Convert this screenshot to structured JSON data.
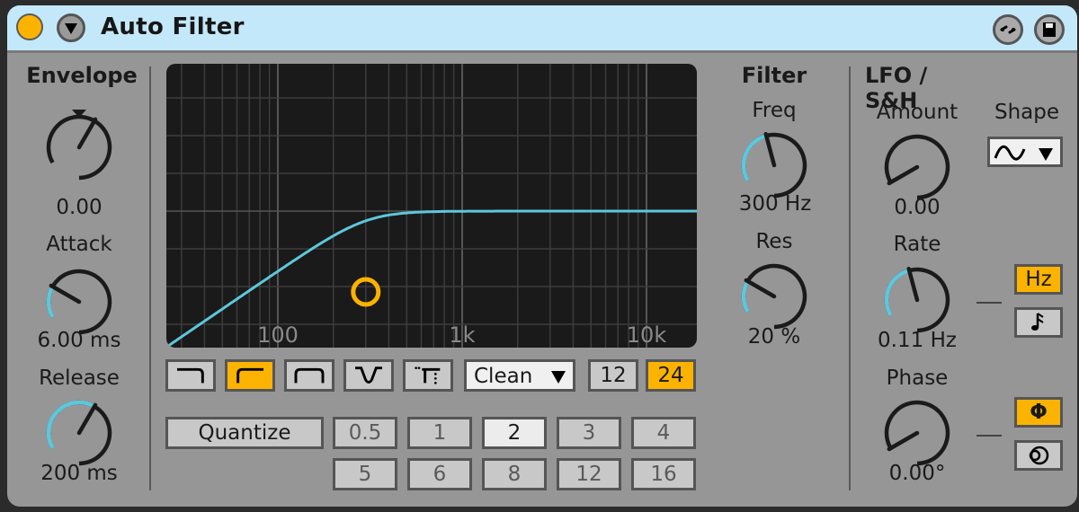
{
  "device": {
    "title": "Auto Filter",
    "power_on": true,
    "icons": {
      "power": "device-power-icon",
      "collapse": "triangle-down-icon",
      "hotswap": "hot-swap-icon",
      "save": "save-preset-icon"
    }
  },
  "envelope": {
    "title": "Envelope",
    "amount": {
      "label": "",
      "value": "0.00",
      "position": 0.5,
      "bipolar": true
    },
    "attack": {
      "label": "Attack",
      "value": "6.00 ms",
      "position": 0.2
    },
    "release": {
      "label": "Release",
      "value": "200 ms",
      "position": 0.5
    }
  },
  "graph": {
    "freq_labels": [
      "100",
      "1k",
      "10k"
    ],
    "filter_type_buttons": [
      {
        "name": "lowpass",
        "icon": "lowpass-icon",
        "active": false
      },
      {
        "name": "highpass",
        "icon": "highpass-icon",
        "active": true
      },
      {
        "name": "bandpass",
        "icon": "bandpass-icon",
        "active": false
      },
      {
        "name": "notch",
        "icon": "notch-icon",
        "active": false
      },
      {
        "name": "morph",
        "icon": "morph-icon",
        "active": false
      }
    ],
    "circuit": {
      "selected": "Clean"
    },
    "slope_buttons": [
      {
        "label": "12",
        "active": false
      },
      {
        "label": "24",
        "active": true
      }
    ],
    "cutoff_hz": 300,
    "resonance_pct": 20,
    "colors": {
      "curve": "#5ec7dc",
      "handle": "#fcb300",
      "background": "#1a1a1a",
      "grid": "#3c3c3c"
    }
  },
  "quantize": {
    "label": "Quantize",
    "row1": [
      {
        "label": "0.5",
        "selected": false,
        "dim": true
      },
      {
        "label": "1",
        "selected": false,
        "dim": true
      },
      {
        "label": "2",
        "selected": true,
        "dim": false
      },
      {
        "label": "3",
        "selected": false,
        "dim": true
      },
      {
        "label": "4",
        "selected": false,
        "dim": true
      }
    ],
    "row2": [
      {
        "label": "5",
        "selected": false,
        "dim": true
      },
      {
        "label": "6",
        "selected": false,
        "dim": true
      },
      {
        "label": "8",
        "selected": false,
        "dim": true
      },
      {
        "label": "12",
        "selected": false,
        "dim": true
      },
      {
        "label": "16",
        "selected": false,
        "dim": true
      }
    ]
  },
  "filter": {
    "title": "Filter",
    "freq": {
      "label": "Freq",
      "value": "300 Hz",
      "position": 0.35
    },
    "res": {
      "label": "Res",
      "value": "20 %",
      "position": 0.2
    }
  },
  "lfo": {
    "title": "LFO / S&H",
    "amount": {
      "label": "Amount",
      "value": "0.00",
      "position": 0.0
    },
    "shape": {
      "label": "Shape",
      "selected": "sine-wave-icon"
    },
    "rate": {
      "label": "Rate",
      "value": "0.11 Hz",
      "position": 0.35
    },
    "rate_mode": [
      {
        "label": "Hz",
        "icon": "",
        "active": true
      },
      {
        "label": "",
        "icon": "sync-note-icon",
        "active": false
      }
    ],
    "phase": {
      "label": "Phase",
      "value": "0.00°",
      "position": 0.0
    },
    "phase_mode": [
      {
        "label": "Φ",
        "icon": "phase-icon",
        "active": true
      },
      {
        "label": "",
        "icon": "spin-icon",
        "active": false
      }
    ]
  },
  "colors": {
    "accent": "#fcb300",
    "modulation": "#5ec7dc",
    "panel": "#969696",
    "title_bar": "#c3e8fa"
  }
}
